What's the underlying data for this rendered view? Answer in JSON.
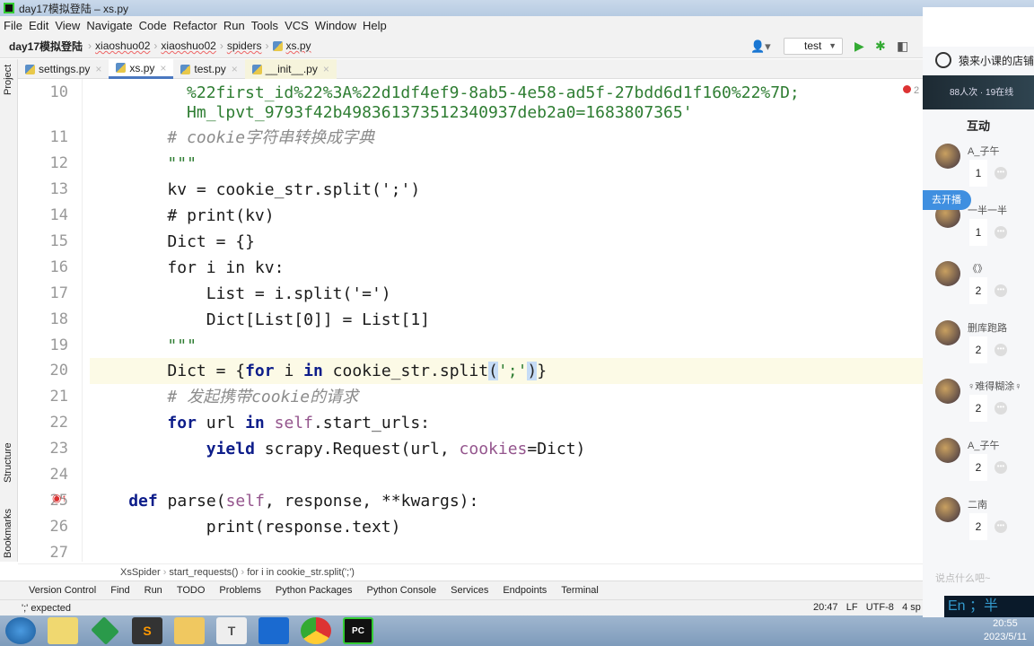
{
  "window": {
    "title": "day17模拟登陆 – xs.py"
  },
  "menu": [
    "File",
    "Edit",
    "View",
    "Navigate",
    "Code",
    "Refactor",
    "Run",
    "Tools",
    "VCS",
    "Window",
    "Help"
  ],
  "breadcrumb": {
    "project": "day17模拟登陆",
    "items": [
      "xiaoshuo02",
      "xiaoshuo02",
      "spiders"
    ],
    "file": "xs.py"
  },
  "toolbar": {
    "run_config": "test"
  },
  "tabs": [
    {
      "label": "settings.py"
    },
    {
      "label": "xs.py",
      "active": true
    },
    {
      "label": "test.py"
    },
    {
      "label": "__init__.py"
    }
  ],
  "left_tools": {
    "project": "Project",
    "structure": "Structure",
    "bookmarks": "Bookmarks"
  },
  "problems_count": "2",
  "code": [
    {
      "num": "10",
      "t": [
        [
          "s",
          " %22first_id%22%3A%22d1df4ef9-8ab5-4e58-ad5f-27bdd6d1f160%22%7D;"
        ]
      ]
    },
    {
      "num": "",
      "t": [
        [
          "s",
          " Hm_lpvt_9793f42b498361373512340937deb2a0=1683807365'"
        ]
      ]
    },
    {
      "num": "11",
      "t": [
        [
          "c",
          "# cookie字符串转换成字典"
        ]
      ]
    },
    {
      "num": "12",
      "t": [
        [
          "s",
          "\"\"\""
        ]
      ]
    },
    {
      "num": "13",
      "t": [
        [
          "n",
          "kv = cookie_str.split(';')"
        ]
      ]
    },
    {
      "num": "14",
      "t": [
        [
          "n",
          "# print(kv)"
        ]
      ]
    },
    {
      "num": "15",
      "t": [
        [
          "n",
          "Dict = {}"
        ]
      ]
    },
    {
      "num": "16",
      "t": [
        [
          "n",
          "for i in kv:"
        ]
      ]
    },
    {
      "num": "17",
      "t": [
        [
          "n",
          "    List = i.split('=')"
        ]
      ]
    },
    {
      "num": "18",
      "t": [
        [
          "n",
          "    Dict[List[0]] = List[1]"
        ]
      ]
    },
    {
      "num": "19",
      "t": [
        [
          "s",
          "\"\"\""
        ]
      ]
    },
    {
      "num": "20",
      "hl": true,
      "t": [
        [
          "n",
          "Dict = {"
        ],
        [
          "k",
          "for"
        ],
        [
          "n",
          " i "
        ],
        [
          "k",
          "in"
        ],
        [
          "n",
          " cookie_str.split"
        ],
        [
          "br",
          "("
        ],
        [
          "s",
          "';'"
        ],
        [
          "br",
          ")"
        ],
        [
          "n",
          "}"
        ]
      ]
    },
    {
      "num": "21",
      "t": [
        [
          "c",
          "# 发起携带cookie的请求"
        ]
      ]
    },
    {
      "num": "22",
      "t": [
        [
          "k",
          "for"
        ],
        [
          "n",
          " url "
        ],
        [
          "k",
          "in"
        ],
        [
          "p",
          " self"
        ],
        [
          "n",
          ".start_urls:"
        ]
      ]
    },
    {
      "num": "23",
      "t": [
        [
          "k",
          "    yield"
        ],
        [
          "n",
          " scrapy.Request(url, "
        ],
        [
          "p",
          "cookies"
        ],
        [
          "n",
          "=Dict)"
        ]
      ]
    },
    {
      "num": "24",
      "t": []
    },
    {
      "num": "25",
      "t": [
        [
          "k",
          "def"
        ],
        [
          "n",
          " parse("
        ],
        [
          "p",
          "self"
        ],
        [
          "n",
          ", response, **kwargs):"
        ]
      ]
    },
    {
      "num": "26",
      "t": [
        [
          "n",
          "    print(response.text)"
        ]
      ]
    },
    {
      "num": "27",
      "t": []
    }
  ],
  "code_indent": [
    9,
    9,
    8,
    8,
    8,
    8,
    8,
    8,
    8,
    8,
    8,
    8,
    8,
    8,
    8,
    0,
    4,
    8,
    0
  ],
  "editor_breadcrumb": [
    "XsSpider",
    "start_requests()",
    "for i in cookie_str.split(';')"
  ],
  "tool_windows": [
    "Version Control",
    "Find",
    "Run",
    "TODO",
    "Problems",
    "Python Packages",
    "Python Console",
    "Services",
    "Endpoints",
    "Terminal"
  ],
  "status": {
    "message": "';' expected",
    "position": "20:47",
    "line_sep": "LF",
    "encoding": "UTF-8",
    "indent": "4 sp"
  },
  "taskbar": {
    "time": "20:55",
    "date": "2023/5/11"
  },
  "side_panel": {
    "shop": "猿来小课的店铺",
    "live_stats": "88人次 · 19在线",
    "heading": "互动",
    "go_live": "去开播",
    "input_placeholder": "说点什么吧~",
    "users": [
      {
        "name": "A_子午",
        "count": "1"
      },
      {
        "name": "一半一半",
        "count": "1"
      },
      {
        "name": "《》",
        "count": "2"
      },
      {
        "name": "删库跑路",
        "count": "2"
      },
      {
        "name": "♀难得糊涂♀",
        "count": "2"
      },
      {
        "name": "A_子午",
        "count": "2"
      },
      {
        "name": "二南",
        "count": "2"
      }
    ]
  },
  "ime": "En ；半"
}
